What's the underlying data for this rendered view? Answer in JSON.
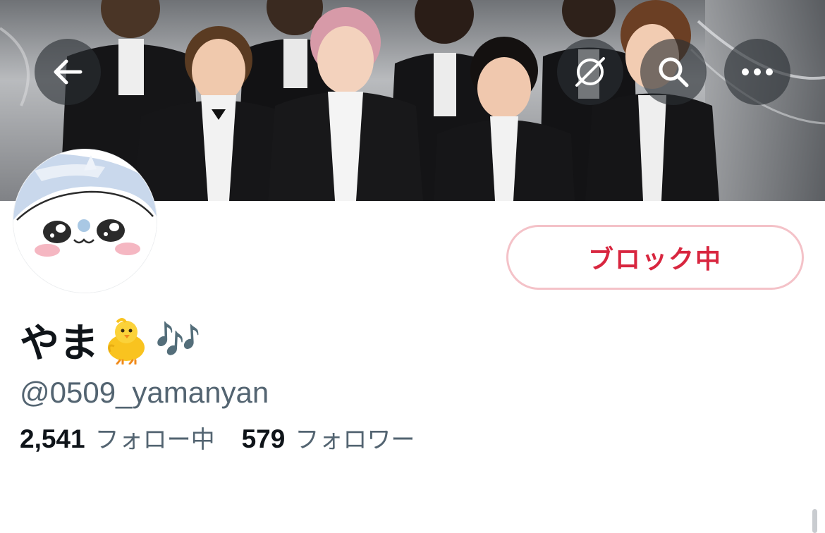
{
  "header": {
    "back_icon": "arrow-left-icon",
    "blocked_link_icon": "no-link-icon",
    "search_icon": "search-icon",
    "more_icon": "more-horizontal-icon"
  },
  "profile": {
    "display_name": "やま",
    "name_emoji_chick": "🐥",
    "name_emoji_notes": "🎶",
    "handle": "@0509_yamanyan",
    "block_button_label": "ブロック中",
    "following_count": "2,541",
    "following_label": "フォロー中",
    "followers_count": "579",
    "followers_label": "フォロワー"
  },
  "colors": {
    "block_text": "#d8263f",
    "block_border": "#f4c2c8",
    "secondary_text": "#536471",
    "primary_text": "#0f1419"
  }
}
